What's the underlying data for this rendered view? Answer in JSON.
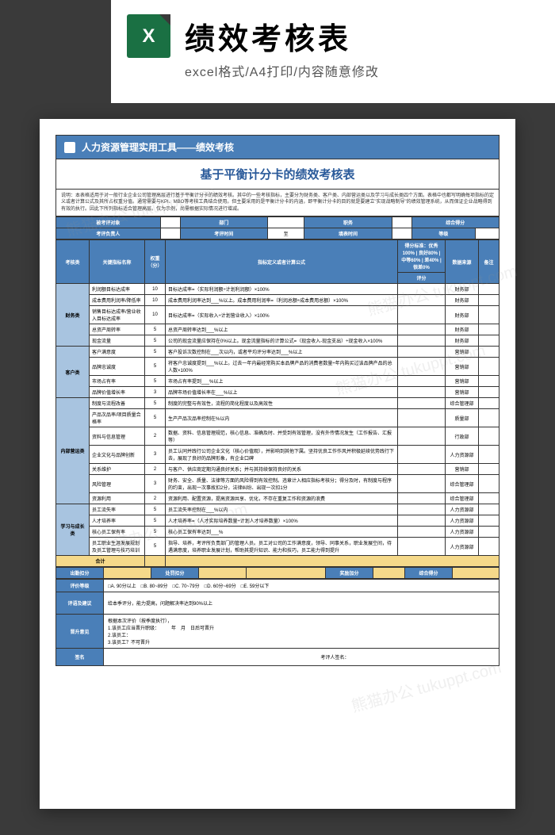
{
  "header": {
    "icon_label": "X",
    "title": "绩效考核表",
    "subtitle": "excel格式/A4打印/内容随意修改"
  },
  "doc": {
    "banner": "人力资源管理实用工具——绩效考核",
    "title": "基于平衡计分卡的绩效考核表",
    "description": "说明：本表格适用于对一般行业企业公司管理高层进行基于平衡计分卡的绩效考核。其中的一些考核指标，主要分为财务类、客户类、内部营运类以及学习与成长类四个方面。表格中也都写明确每项指标的定义或者计算公式及其所占权重分值。通常需要与KPI、MBO等考核工具结合使用。但主要采用的是平衡计分卡的内涵，即平衡计分卡的目的就是要建立\"实现战略制导\"的绩效管理系统，从而保证企业战略得到有效的执行。因此下所列指标适合管理高层。仅为示例，尚需根据实际情况进行增减。"
  },
  "info_rows": {
    "r1": {
      "l1": "被考评对象",
      "l2": "部门",
      "l3": "职务",
      "l4": "综合得分"
    },
    "r2": {
      "l1": "考评负责人",
      "l2": "考评时间",
      "l3": "至",
      "l4": "填表时间",
      "l5": "等级"
    }
  },
  "table_headers": {
    "h1": "考核类",
    "h2": "关键指标名称",
    "h3": "权重（分）",
    "h4": "指标定义或者计算公式",
    "h5": "得分标准：优秀100% | 良好80% | 中等60% | 差40% | 很差0%",
    "h6": "数据来源",
    "h7": "备注",
    "h8": "评分"
  },
  "categories": [
    {
      "name": "财务类",
      "rows": [
        {
          "indicator": "利润额目标达成率",
          "weight": "10",
          "formula": "目标达成率=（实际利润额÷计划利润额）×100%",
          "source": "财务部"
        },
        {
          "indicator": "成本费用利润率/降低率",
          "weight": "10",
          "formula": "成本费用利润率达到___%以上。成本费用利润率=（利润总额÷成本费用总额）×100%",
          "source": "财务部"
        },
        {
          "indicator": "销售目标达成率/营业收入目标达成率",
          "weight": "10",
          "formula": "目标达成率=（实际收入÷计划营业收入）×100%",
          "source": "财务部"
        },
        {
          "indicator": "总资产周转率",
          "weight": "5",
          "formula": "总资产周转率达到___%以上",
          "source": "财务部"
        },
        {
          "indicator": "现金流量",
          "weight": "5",
          "formula": "公司的现金流量应保持在0%以上。现金流量指标的计算公式=（现金收入-现金支出）÷现金收入×100%",
          "source": "财务部"
        }
      ]
    },
    {
      "name": "客户类",
      "rows": [
        {
          "indicator": "客户满意度",
          "weight": "5",
          "formula": "客户投诉次数控制在___次以内，或者平均评分率达到___%以上",
          "source": "营销部"
        },
        {
          "indicator": "品牌忠诚度",
          "weight": "5",
          "formula": "将客户忠诚度提到___%以上。过去一年内最经常购买本品牌产品的消费者数量÷年内购买过该品牌产品的总人数×100%",
          "source": "营销部"
        },
        {
          "indicator": "市场占有率",
          "weight": "5",
          "formula": "市场占有率提到___%以上",
          "source": "营销部"
        },
        {
          "indicator": "品牌价值增长率",
          "weight": "3",
          "formula": "品牌市场价值增长率在___%以上",
          "source": "营销部"
        }
      ]
    },
    {
      "name": "内部营运类",
      "rows": [
        {
          "indicator": "制度与流程改善",
          "weight": "5",
          "formula": "制度的完整与有效性，流程的简化程度以及高效性",
          "source": "综合管理部"
        },
        {
          "indicator": "产品次品率/项目质量合格率",
          "weight": "5",
          "formula": "生产产品次品率控制在%以内",
          "source": "质量部"
        },
        {
          "indicator": "资料与信息管理",
          "weight": "2",
          "formula": "数据、资料、信息管理规范，核心信息、准确及时、并受到有效管理，没有外传情况发生（工作报告、汇报等）",
          "source": "行政部"
        },
        {
          "indicator": "企业文化与品牌创新",
          "weight": "3",
          "formula": "员工认同并践行公司企业文化（核心价值观），并影响到其他下属。坚持优良工作作风并积极延续优势践行下去，展现了良好的品牌形象，有企业口碑",
          "source": "人力资源部"
        },
        {
          "indicator": "关系维护",
          "weight": "2",
          "formula": "与客户、供应商定期沟通良好关系；并与其持续保持良好的关系",
          "source": "营销部"
        },
        {
          "indicator": "风险管理",
          "weight": "3",
          "formula": "财务、安全、质量、法律等方面的风险得到有效控制。违章计入相应指标考核分；得分及时，有制度与程序的约束，出现一次事故扣2分，法律纠纷、出现一次扣1分",
          "source": "综合管理部"
        },
        {
          "indicator": "资源利用",
          "weight": "2",
          "formula": "资源利用、配置资源，提高资源共享、优化，不存在重复工作和资源的浪费",
          "source": "综合管理部"
        }
      ]
    },
    {
      "name": "学习与成长类",
      "rows": [
        {
          "indicator": "员工流失率",
          "weight": "5",
          "formula": "员工流失率控制在___%以内",
          "source": "人力资源部"
        },
        {
          "indicator": "人才培养率",
          "weight": "5",
          "formula": "人才培养率=（人才实际培养数量÷计划人才培养数量）×100%",
          "source": "人力资源部"
        },
        {
          "indicator": "核心员工保有率",
          "weight": "5",
          "formula": "核心员工保有率达到___%",
          "source": "人力资源部"
        },
        {
          "indicator": "员工职业生涯发展规划及员工管理与技巧培训",
          "weight": "5",
          "formula": "指导、培养，考评所负责部门的管理人员。员工对公司的工作满意度，领导、同事关系，职业发展空间，待遇满意度，培养职业发展计划，帮助其提升知识、能力和技巧，员工能力得到提升",
          "source": "人力资源部"
        }
      ]
    }
  ],
  "total_label": "合计",
  "bonus": {
    "l1": "出勤扣分",
    "l2": "处罚扣分",
    "l3": "奖励加分",
    "l4": "综合得分"
  },
  "rating": {
    "label": "评价等级",
    "text": "□A. 90分以上　□B. 80~89分　□C. 70~79分　□D. 60分~69分　□E. 59分以下"
  },
  "comment": {
    "label": "评语及建议",
    "text": "给本季评分，能力提高，问题解决率达到90%以上"
  },
  "promotion": {
    "label": "晋升意见",
    "text": "根据本次评价（按季度执行），\n1.该员工应当晋升职级：　　　年　月　日后可晋升\n2.该员工：\n3.该员工？不可晋升"
  },
  "signature": {
    "l1": "签名",
    "l2": "考评人签名："
  },
  "watermark": "熊猫办公 tukuppt.com"
}
